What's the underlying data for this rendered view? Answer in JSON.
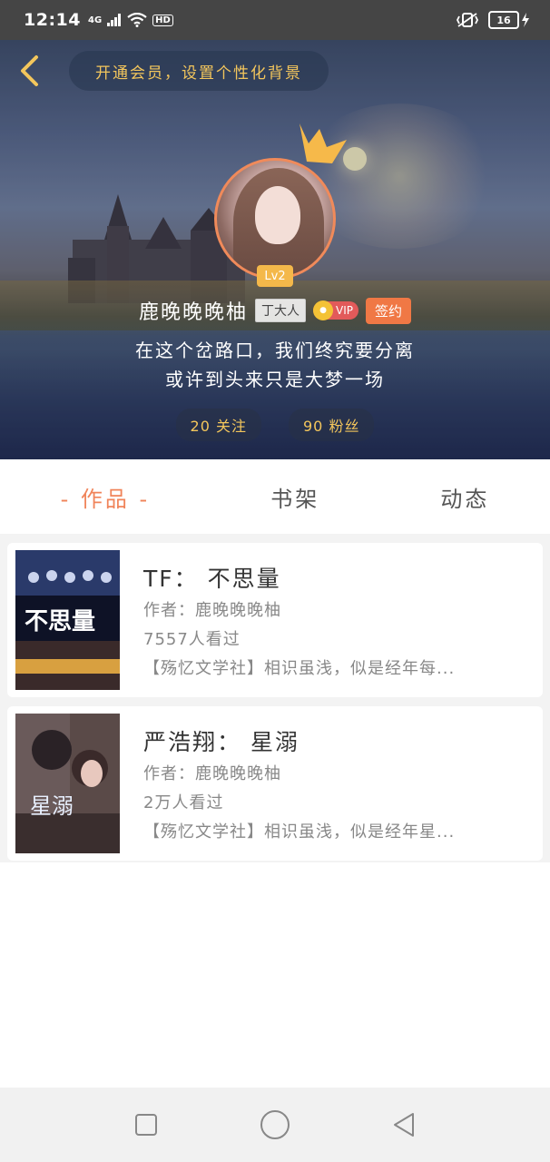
{
  "status_bar": {
    "time": "12:14",
    "network": "4G",
    "hd": "HD",
    "battery": "16"
  },
  "header": {
    "member_prompt": "开通会员，设置个性化背景",
    "level": "Lv2",
    "username": "鹿晚晚晚柚",
    "nickname_tag": "丁大人",
    "vip_label": "VIP",
    "signed_label": "签约",
    "bio_line1": "在这个岔路口，我们终究要分离",
    "bio_line2": "或许到头来只是大梦一场",
    "following": "20 关注",
    "followers": "90 粉丝"
  },
  "tabs": [
    {
      "label": "作品",
      "active": true
    },
    {
      "label": "书架",
      "active": false
    },
    {
      "label": "动态",
      "active": false
    }
  ],
  "works": [
    {
      "title": "TF：  不思量",
      "author": "作者：鹿晚晚晚柚",
      "views": "7557人看过",
      "desc": "【殇忆文学社】相识虽浅，似是经年每...",
      "cover_text": "不思量"
    },
    {
      "title": "严浩翔：  星溺",
      "author": "作者：鹿晚晚晚柚",
      "views": "2万人看过",
      "desc": "【殇忆文学社】相识虽浅，似是经年星...",
      "cover_text": "星溺"
    }
  ],
  "colors": {
    "accent": "#f0845a",
    "gold": "#f3c65c",
    "signed": "#f07845"
  }
}
